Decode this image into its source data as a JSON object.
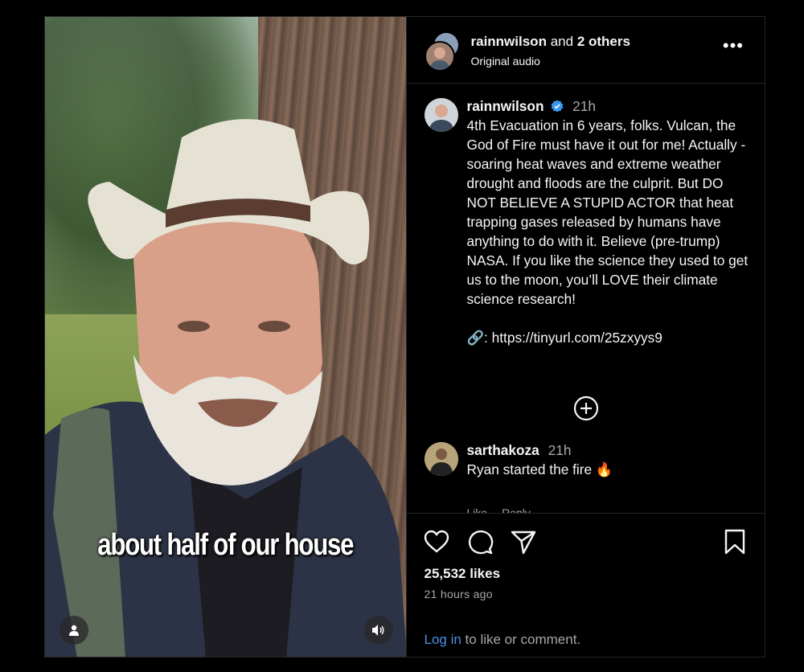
{
  "video": {
    "caption": "about half of our house"
  },
  "header": {
    "username": "rainnwilson",
    "and_text": "and",
    "others": "2 others",
    "audio": "Original audio",
    "more": "•••"
  },
  "post": {
    "username": "rainnwilson",
    "time": "21h",
    "text": "4th Evacuation in 6 years, folks. Vulcan, the God of Fire must have it out for me! Actually - soaring heat waves and extreme weather drought and floods are the culprit. But DO NOT BELIEVE A STUPID ACTOR that heat trapping gases released by humans have anything to do with it. Believe (pre-trump) NASA. If you like the science they used to get us to the moon, you’ll LOVE their climate science research!",
    "link": "🔗: https://tinyurl.com/25zxyys9"
  },
  "comment": {
    "username": "sarthakoza",
    "time": "21h",
    "text": "Ryan started the fire 🔥",
    "like": "Like",
    "reply": "Reply"
  },
  "footer": {
    "likes": "25,532 likes",
    "ago": "21 hours ago",
    "login_link": "Log in",
    "login_rest": " to like or comment."
  },
  "colors": {
    "link": "#4a90e2",
    "verified": "#3897f0",
    "muted": "#a8a8a8",
    "divider": "#262626"
  }
}
